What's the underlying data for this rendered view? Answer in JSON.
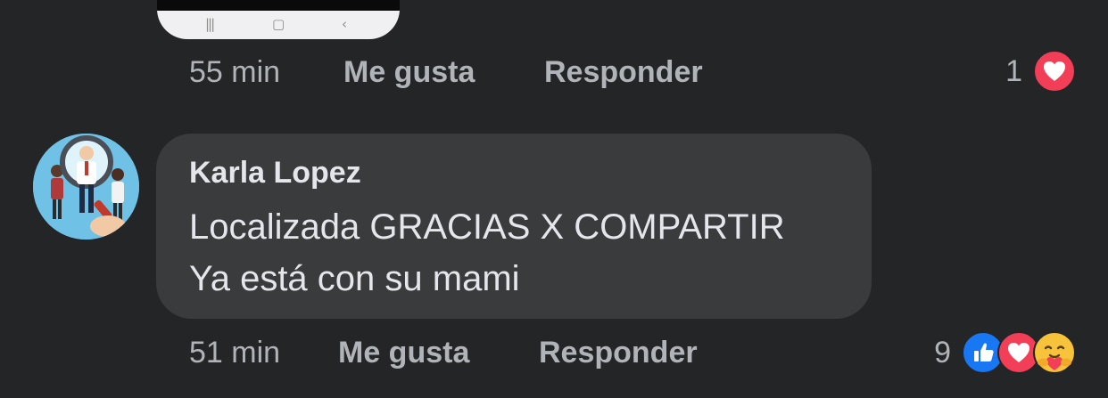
{
  "previous_comment": {
    "timestamp": "55 min",
    "like_label": "Me gusta",
    "reply_label": "Responder",
    "reaction_count": "1",
    "reactions": [
      "love-icon"
    ],
    "phone_nav_icons": [
      "recents-icon",
      "home-icon",
      "back-icon"
    ]
  },
  "comment": {
    "author": "Karla Lopez",
    "lines": [
      "Localizada GRACIAS X COMPARTIR",
      "Ya está con su mami"
    ],
    "timestamp": "51 min",
    "like_label": "Me gusta",
    "reply_label": "Responder",
    "reaction_count": "9",
    "reactions": [
      "like-icon",
      "love-icon",
      "care-icon"
    ]
  },
  "colors": {
    "background": "#242526",
    "bubble": "#3a3b3c",
    "primary_text": "#e4e6eb",
    "secondary_text": "#b0b3b8",
    "love": "#f33e58",
    "like": "#1877f2",
    "care": "#f7c33a",
    "avatar_bg": "#6fc2e6"
  }
}
